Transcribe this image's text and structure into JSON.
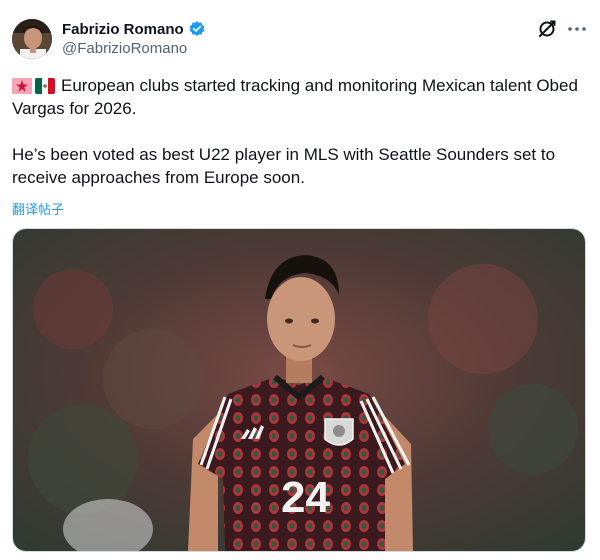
{
  "author": {
    "display_name": "Fabrizio Romano",
    "handle": "@FabrizioRomano",
    "verified": true
  },
  "tweet": {
    "flag_icons": [
      "siren-emoji",
      "mexico-flag-emoji"
    ],
    "line1": "European clubs started tracking and monitoring Mexican talent Obed Vargas for 2026.",
    "line2": "He’s been voted as best U22 player in MLS with Seattle Sounders set to receive approaches from Europe soon."
  },
  "translate_label": "翻译帖子",
  "media": {
    "jersey_number": "24"
  },
  "icons": {
    "grok": "grok-icon",
    "more": "more-icon",
    "verified": "verified-badge-icon"
  },
  "colors": {
    "link": "#1d9bf0",
    "verified": "#1d9bf0",
    "secondary_text": "#536471"
  }
}
